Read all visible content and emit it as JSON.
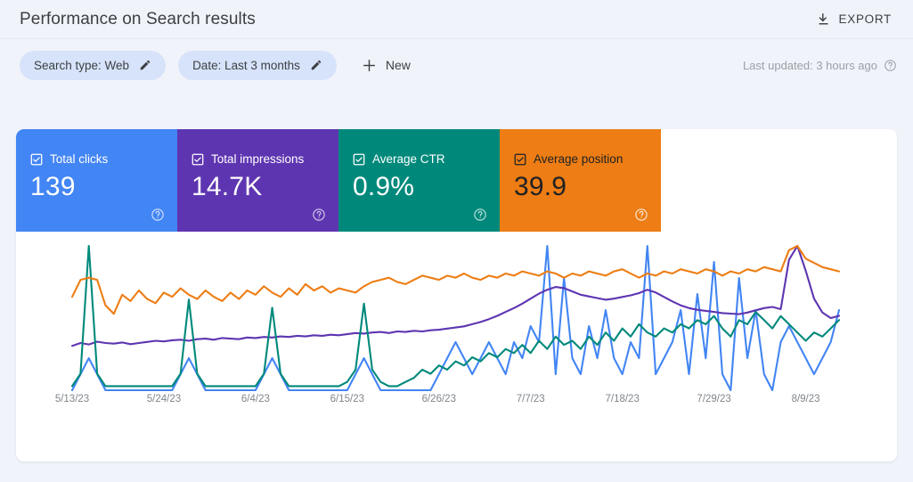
{
  "header": {
    "title": "Performance on Search results",
    "export_label": "EXPORT",
    "export_icon": "download-icon"
  },
  "filters": {
    "chips": [
      {
        "label": "Search type: Web",
        "icon": "pencil-icon"
      },
      {
        "label": "Date: Last 3 months",
        "icon": "pencil-icon"
      }
    ],
    "new_label": "New",
    "new_icon": "plus-icon",
    "last_updated": "Last updated: 3 hours ago",
    "help_icon": "help-circle-icon"
  },
  "metrics": [
    {
      "name": "Total clicks",
      "value": "139",
      "color": "#4285f4",
      "text": "light",
      "checked": true,
      "help_icon": "help-circle-icon"
    },
    {
      "name": "Total impressions",
      "value": "14.7K",
      "color": "#5e35b1",
      "text": "light",
      "checked": true,
      "help_icon": "help-circle-icon"
    },
    {
      "name": "Average CTR",
      "value": "0.9%",
      "color": "#00897b",
      "text": "light",
      "checked": true,
      "help_icon": "help-circle-icon"
    },
    {
      "name": "Average position",
      "value": "39.9",
      "color": "#ed7d14",
      "text": "dark",
      "checked": true,
      "help_icon": "help-circle-icon"
    }
  ],
  "chart_data": {
    "type": "line",
    "title": "Performance on Search results",
    "xlabel": "",
    "ylabel": "",
    "grid": false,
    "legend": "metric-tiles-above",
    "x_tick_labels": [
      "5/13/23",
      "5/24/23",
      "6/4/23",
      "6/15/23",
      "6/26/23",
      "7/7/23",
      "7/18/23",
      "7/29/23",
      "8/9/23"
    ],
    "x_tick_indices": [
      0,
      11,
      22,
      33,
      44,
      55,
      66,
      77,
      88
    ],
    "n_points": 93,
    "series": [
      {
        "name": "Total clicks",
        "color": "#4285f4",
        "values": [
          0,
          1,
          2,
          1,
          0,
          0,
          0,
          0,
          0,
          0,
          0,
          0,
          0,
          1,
          2,
          1,
          0,
          0,
          0,
          0,
          0,
          0,
          0,
          1,
          2,
          1,
          0,
          0,
          0,
          0,
          0,
          0,
          0,
          0,
          1,
          2,
          1,
          0,
          0,
          0,
          0,
          0,
          0,
          0,
          1,
          2,
          3,
          2,
          1,
          2,
          3,
          2,
          1,
          3,
          2,
          4,
          3,
          9,
          1,
          7,
          2,
          1,
          4,
          2,
          5,
          2,
          1,
          3,
          2,
          9,
          1,
          2,
          3,
          5,
          1,
          6,
          2,
          8,
          1,
          0,
          7,
          2,
          5,
          1,
          0,
          3,
          4,
          3,
          2,
          1,
          2,
          3,
          5
        ]
      },
      {
        "name": "Total impressions",
        "color": "#5e35b1",
        "values": [
          160,
          170,
          165,
          175,
          170,
          168,
          172,
          166,
          170,
          174,
          178,
          176,
          180,
          182,
          178,
          184,
          186,
          182,
          188,
          186,
          184,
          190,
          188,
          192,
          190,
          194,
          192,
          196,
          194,
          198,
          196,
          200,
          198,
          202,
          206,
          204,
          208,
          210,
          206,
          212,
          210,
          214,
          212,
          216,
          218,
          222,
          226,
          230,
          238,
          246,
          256,
          268,
          282,
          296,
          312,
          330,
          348,
          362,
          372,
          368,
          356,
          344,
          338,
          332,
          326,
          330,
          336,
          342,
          350,
          362,
          352,
          336,
          320,
          306,
          296,
          290,
          286,
          282,
          278,
          276,
          274,
          280,
          288,
          296,
          300,
          292,
          470,
          520,
          430,
          330,
          280,
          260,
          268
        ]
      },
      {
        "name": "Average CTR",
        "color": "#00897b",
        "values": [
          0.1,
          0.4,
          3.5,
          0.4,
          0.1,
          0.1,
          0.1,
          0.1,
          0.1,
          0.1,
          0.1,
          0.1,
          0.1,
          0.4,
          2.2,
          0.4,
          0.1,
          0.1,
          0.1,
          0.1,
          0.1,
          0.1,
          0.1,
          0.4,
          2.0,
          0.4,
          0.1,
          0.1,
          0.1,
          0.1,
          0.1,
          0.1,
          0.1,
          0.2,
          0.5,
          2.1,
          0.5,
          0.2,
          0.1,
          0.1,
          0.2,
          0.3,
          0.5,
          0.4,
          0.6,
          0.5,
          0.7,
          0.6,
          0.8,
          0.7,
          0.9,
          0.8,
          1.0,
          0.9,
          1.1,
          0.9,
          1.2,
          1.0,
          1.3,
          1.1,
          1.2,
          1.0,
          1.3,
          1.1,
          1.4,
          1.2,
          1.5,
          1.3,
          1.6,
          1.4,
          1.3,
          1.5,
          1.4,
          1.6,
          1.5,
          1.7,
          1.6,
          1.8,
          1.5,
          1.3,
          1.7,
          1.6,
          1.9,
          1.7,
          1.5,
          1.8,
          1.6,
          1.4,
          1.2,
          1.4,
          1.3,
          1.5,
          1.7
        ]
      },
      {
        "name": "Average position",
        "color": "#ed7d14",
        "values": [
          44,
          52,
          53,
          52,
          40,
          36,
          45,
          42,
          47,
          43,
          41,
          46,
          44,
          48,
          45,
          43,
          47,
          44,
          42,
          46,
          43,
          47,
          45,
          49,
          46,
          44,
          48,
          45,
          50,
          47,
          49,
          46,
          48,
          47,
          46,
          49,
          51,
          52,
          53,
          51,
          50,
          52,
          54,
          53,
          52,
          54,
          53,
          55,
          53,
          52,
          54,
          53,
          55,
          54,
          56,
          55,
          54,
          56,
          55,
          53,
          55,
          54,
          56,
          55,
          54,
          56,
          57,
          55,
          53,
          55,
          54,
          56,
          55,
          57,
          56,
          55,
          57,
          56,
          54,
          56,
          55,
          57,
          56,
          58,
          57,
          56,
          66,
          68,
          62,
          60,
          58,
          57,
          56
        ]
      }
    ]
  }
}
